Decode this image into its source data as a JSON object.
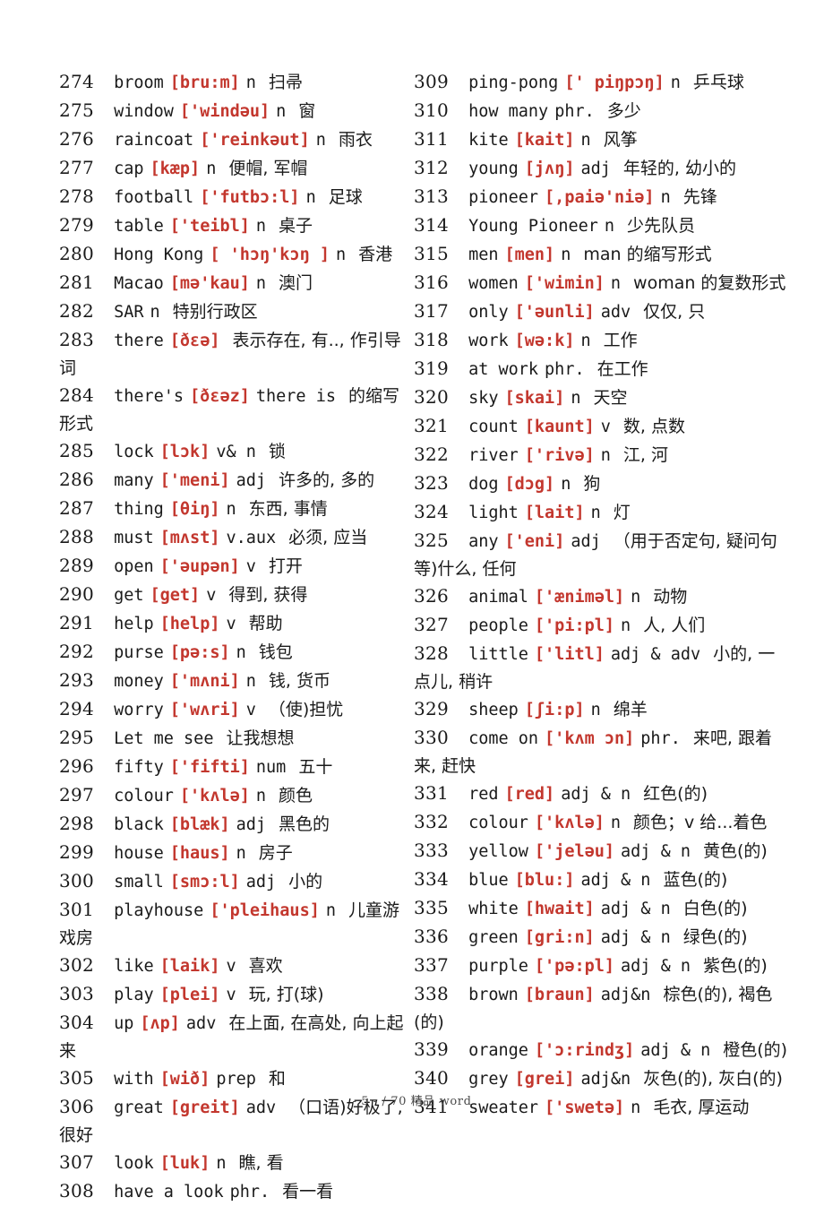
{
  "page": {
    "footer": "- 5 -  /  70 精品 word",
    "accent_red": "#c3372e",
    "text_color": "#1a1a1a",
    "background": "#ffffff"
  },
  "columns": {
    "left": {
      "entries": [
        {
          "num": "274",
          "word": "broom",
          "ipa": "[bru:m]",
          "pos": "n",
          "cn": "扫帚"
        },
        {
          "num": "275",
          "word": "window",
          "ipa": "['windəu]",
          "pos": "n",
          "cn": "窗"
        },
        {
          "num": "276",
          "word": "raincoat",
          "ipa": "['reinkəut]",
          "pos": "n",
          "cn": "雨衣"
        },
        {
          "num": "277",
          "word": "cap",
          "ipa": "[kæp]",
          "pos": "n",
          "cn": "便帽, 军帽"
        },
        {
          "num": "278",
          "word": "football",
          "ipa": "['futbɔ:l]",
          "pos": "n",
          "cn": "足球"
        },
        {
          "num": "279",
          "word": "table",
          "ipa": "['teibl]",
          "pos": "n",
          "cn": "桌子"
        },
        {
          "num": "280",
          "word": "Hong Kong",
          "ipa": "[ 'hɔŋ'kɔŋ ]",
          "pos": "n",
          "cn": "香港"
        },
        {
          "num": "281",
          "word": "Macao",
          "ipa": "[mə'kau]",
          "pos": "n",
          "cn": "澳门"
        },
        {
          "num": "282",
          "word": "SAR",
          "ipa": "",
          "pos": "n",
          "cn": "特别行政区"
        },
        {
          "num": "283",
          "word": "there",
          "ipa": "[ðɛə]",
          "pos": "",
          "cn": "表示存在, 有.., 作引导词"
        },
        {
          "num": "284",
          "word": "there's",
          "ipa": "[ðɛəz]",
          "pos": "there is",
          "cn": "的缩写形式"
        },
        {
          "num": "285",
          "word": "lock",
          "ipa": "[lɔk]",
          "pos": "v& n",
          "cn": "锁"
        },
        {
          "num": "286",
          "word": "many",
          "ipa": "['meni]",
          "pos": "adj",
          "cn": "许多的, 多的"
        },
        {
          "num": "287",
          "word": "thing",
          "ipa": "[θiŋ]",
          "pos": "n",
          "cn": "东西, 事情"
        },
        {
          "num": "288",
          "word": "must",
          "ipa": "[mʌst]",
          "pos": "v.aux",
          "cn": "必须, 应当"
        },
        {
          "num": "289",
          "word": "open",
          "ipa": "['əupən]",
          "pos": "v",
          "cn": "打开"
        },
        {
          "num": "290",
          "word": "get",
          "ipa": "[get]",
          "pos": "v",
          "cn": "得到, 获得"
        },
        {
          "num": "291",
          "word": "help",
          "ipa": "[help]",
          "pos": "v",
          "cn": "帮助"
        },
        {
          "num": "292",
          "word": "purse",
          "ipa": "[pə:s]",
          "pos": "n",
          "cn": "钱包"
        },
        {
          "num": "293",
          "word": "money",
          "ipa": "['mʌni]",
          "pos": "n",
          "cn": "钱, 货币"
        },
        {
          "num": "294",
          "word": "worry",
          "ipa": "['wʌri]",
          "pos": "v",
          "cn": "（使)担忧"
        },
        {
          "num": "295",
          "word": "Let me see",
          "ipa": "",
          "pos": "",
          "cn": "让我想想"
        },
        {
          "num": "296",
          "word": "fifty",
          "ipa": "['fifti]",
          "pos": "num",
          "cn": "五十"
        },
        {
          "num": "297",
          "word": "colour",
          "ipa": "['kʌlə]",
          "pos": "n",
          "cn": "颜色"
        },
        {
          "num": "298",
          "word": "black",
          "ipa": "[blæk]",
          "pos": "adj",
          "cn": "黑色的"
        },
        {
          "num": "299",
          "word": "house",
          "ipa": "[haus]",
          "pos": "n",
          "cn": "房子"
        },
        {
          "num": "300",
          "word": "small",
          "ipa": "[smɔ:l]",
          "pos": "adj",
          "cn": "小的"
        },
        {
          "num": "301",
          "word": "playhouse",
          "ipa": "['pleihaus]",
          "pos": "n",
          "cn": "儿童游戏房"
        },
        {
          "num": "302",
          "word": "like",
          "ipa": "[laik]",
          "pos": "v",
          "cn": "喜欢"
        },
        {
          "num": "303",
          "word": "play",
          "ipa": "[plei]",
          "pos": "v",
          "cn": "玩, 打(球)"
        },
        {
          "num": "304",
          "word": "up",
          "ipa": "[ʌp]",
          "pos": "adv",
          "cn": "在上面, 在高处, 向上起来"
        },
        {
          "num": "305",
          "word": "with",
          "ipa": "[wið]",
          "pos": "prep",
          "cn": "和"
        },
        {
          "num": "306",
          "word": "great",
          "ipa": "[greit]",
          "pos": "adv",
          "cn": "（口语)好极了, 很好"
        },
        {
          "num": "307",
          "word": "look",
          "ipa": "[luk]",
          "pos": "n",
          "cn": "瞧, 看"
        },
        {
          "num": "308",
          "word": "have a look",
          "ipa": "",
          "pos": "phr.",
          "cn": "看一看"
        }
      ]
    },
    "right": {
      "entries": [
        {
          "num": "309",
          "word": "ping-pong",
          "ipa": "[' piŋpɔŋ]",
          "pos": "n",
          "cn": "乒乓球"
        },
        {
          "num": "310",
          "word": "how many",
          "ipa": "",
          "pos": "phr.",
          "cn": "多少"
        },
        {
          "num": "311",
          "word": "kite",
          "ipa": "[kait]",
          "pos": "n",
          "cn": "风筝"
        },
        {
          "num": "312",
          "word": "young",
          "ipa": "[jʌŋ]",
          "pos": "adj",
          "cn": "年轻的, 幼小的"
        },
        {
          "num": "313",
          "word": "pioneer",
          "ipa": "[,paiə'niə]",
          "pos": "n",
          "cn": "先锋"
        },
        {
          "num": "314",
          "word": "Young Pioneer",
          "ipa": "",
          "pos": "n",
          "cn": "少先队员"
        },
        {
          "num": "315",
          "word": "men",
          "ipa": "[men]",
          "pos": "n",
          "cn": "man 的缩写形式"
        },
        {
          "num": "316",
          "word": "women",
          "ipa": "['wimin]",
          "pos": "n",
          "cn": "woman 的复数形式"
        },
        {
          "num": "317",
          "word": "only",
          "ipa": "['əunli]",
          "pos": "adv",
          "cn": "仅仅, 只"
        },
        {
          "num": "318",
          "word": "work",
          "ipa": "[wə:k]",
          "pos": "n",
          "cn": "工作"
        },
        {
          "num": "319",
          "word": "at work",
          "ipa": "",
          "pos": "phr.",
          "cn": "在工作"
        },
        {
          "num": "320",
          "word": "sky",
          "ipa": "[skai]",
          "pos": "n",
          "cn": "天空"
        },
        {
          "num": "321",
          "word": "count",
          "ipa": "[kaunt]",
          "pos": "v",
          "cn": "数, 点数"
        },
        {
          "num": "322",
          "word": "river",
          "ipa": "['rivə]",
          "pos": "n",
          "cn": "江, 河"
        },
        {
          "num": "323",
          "word": "dog",
          "ipa": "[dɔg]",
          "pos": "n",
          "cn": "狗"
        },
        {
          "num": "324",
          "word": "light",
          "ipa": "[lait]",
          "pos": "n",
          "cn": "灯"
        },
        {
          "num": "325",
          "word": "any",
          "ipa": "['eni]",
          "pos": "adj",
          "cn": "（用于否定句, 疑问句等)什么, 任何"
        },
        {
          "num": "326",
          "word": "animal",
          "ipa": "['æniməl]",
          "pos": "n",
          "cn": "动物"
        },
        {
          "num": "327",
          "word": "people",
          "ipa": "['pi:pl]",
          "pos": "n",
          "cn": "人, 人们"
        },
        {
          "num": "328",
          "word": "little",
          "ipa": "['litl]",
          "pos": "adj & adv",
          "cn": "小的, 一点儿, 稍许"
        },
        {
          "num": "329",
          "word": "sheep",
          "ipa": "[ʃi:p]",
          "pos": "n",
          "cn": "绵羊"
        },
        {
          "num": "330",
          "word": "come on",
          "ipa": "['kʌm ɔn]",
          "pos": "phr.",
          "cn": "来吧, 跟着来, 赶快"
        },
        {
          "num": "331",
          "word": "red",
          "ipa": "[red]",
          "pos": "adj & n",
          "cn": "红色(的)"
        },
        {
          "num": "332",
          "word": "colour",
          "ipa": "['kʌlə]",
          "pos": "n",
          "cn": "颜色；v 给...着色"
        },
        {
          "num": "333",
          "word": "yellow",
          "ipa": "['jeləu]",
          "pos": "adj & n",
          "cn": "黄色(的)"
        },
        {
          "num": "334",
          "word": "blue",
          "ipa": "[blu:]",
          "pos": "adj & n",
          "cn": "蓝色(的)"
        },
        {
          "num": "335",
          "word": "white",
          "ipa": "[hwait]",
          "pos": "adj & n",
          "cn": "白色(的)"
        },
        {
          "num": "336",
          "word": "green",
          "ipa": "[gri:n]",
          "pos": "adj & n",
          "cn": "绿色(的)"
        },
        {
          "num": "337",
          "word": "purple",
          "ipa": "['pə:pl]",
          "pos": "adj & n",
          "cn": "紫色(的)"
        },
        {
          "num": "338",
          "word": "brown",
          "ipa": "[braun]",
          "pos": "adj&n",
          "cn": "棕色(的), 褐色(的)"
        },
        {
          "num": "339",
          "word": "orange",
          "ipa": "['ɔ:rindʒ]",
          "pos": "adj & n",
          "cn": "橙色(的)"
        },
        {
          "num": "340",
          "word": "grey",
          "ipa": "[grei]",
          "pos": "adj&n",
          "cn": "灰色(的), 灰白(的)"
        },
        {
          "num": "341",
          "word": "sweater",
          "ipa": "['swetə]",
          "pos": "n",
          "cn": "毛衣, 厚运动"
        }
      ]
    }
  }
}
